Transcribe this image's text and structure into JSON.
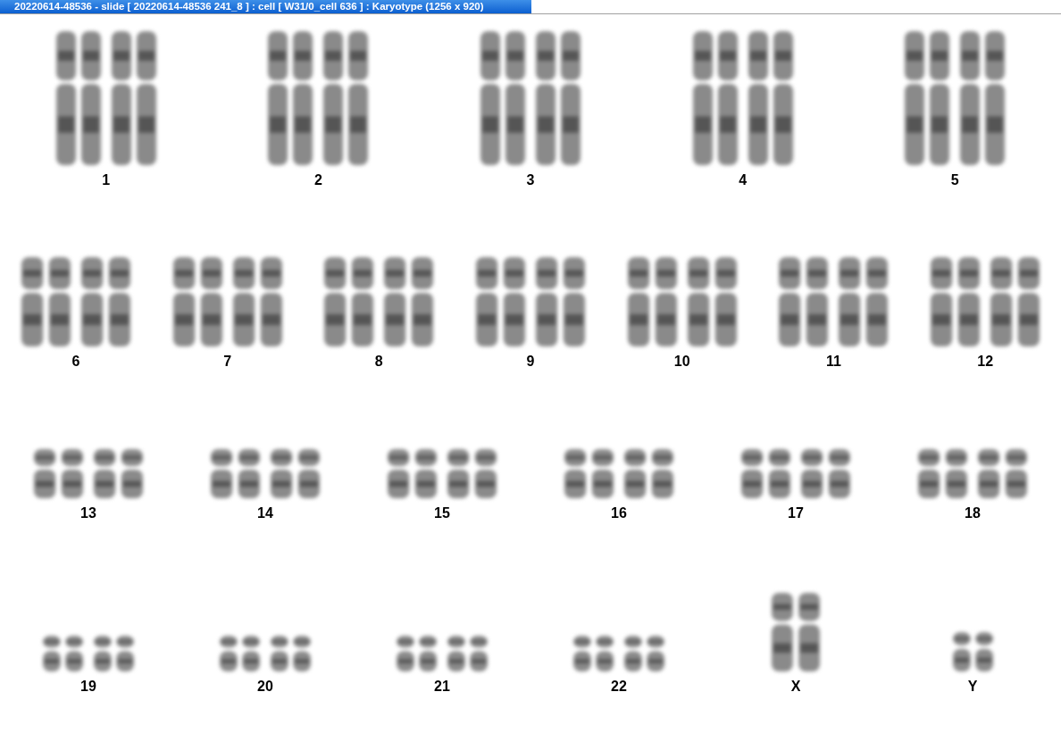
{
  "window": {
    "title": "20220614-48536 - slide [ 20220614-48536 241_8 ] : cell [ W31/0_cell 636 ] : Karyotype  (1256 x 920)"
  },
  "karyotype_rows": [
    {
      "items": [
        {
          "label": "1",
          "kind": "pair"
        },
        {
          "label": "2",
          "kind": "pair"
        },
        {
          "label": "3",
          "kind": "pair"
        },
        {
          "label": "4",
          "kind": "pair"
        },
        {
          "label": "5",
          "kind": "pair"
        }
      ]
    },
    {
      "items": [
        {
          "label": "6",
          "kind": "pair"
        },
        {
          "label": "7",
          "kind": "pair"
        },
        {
          "label": "8",
          "kind": "pair"
        },
        {
          "label": "9",
          "kind": "pair"
        },
        {
          "label": "10",
          "kind": "pair"
        },
        {
          "label": "11",
          "kind": "pair"
        },
        {
          "label": "12",
          "kind": "pair"
        }
      ]
    },
    {
      "items": [
        {
          "label": "13",
          "kind": "pair"
        },
        {
          "label": "14",
          "kind": "pair"
        },
        {
          "label": "15",
          "kind": "pair"
        },
        {
          "label": "16",
          "kind": "pair"
        },
        {
          "label": "17",
          "kind": "pair"
        },
        {
          "label": "18",
          "kind": "pair"
        }
      ]
    },
    {
      "items": [
        {
          "label": "19",
          "kind": "pair"
        },
        {
          "label": "20",
          "kind": "pair"
        },
        {
          "label": "21",
          "kind": "pair"
        },
        {
          "label": "22",
          "kind": "pair"
        },
        {
          "label": "X",
          "kind": "single-tall"
        },
        {
          "label": "Y",
          "kind": "single"
        }
      ]
    }
  ]
}
